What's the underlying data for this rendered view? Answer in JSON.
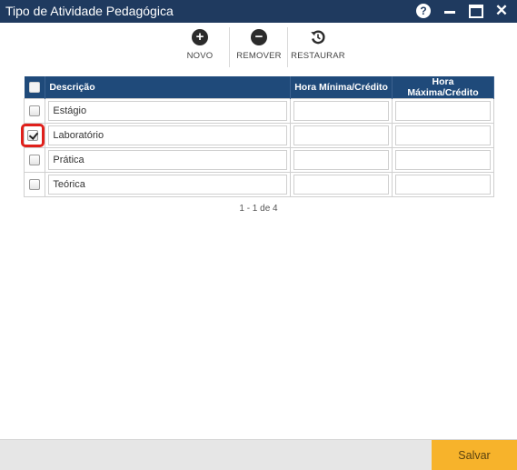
{
  "window": {
    "title": "Tipo de Atividade Pedagógica",
    "help_glyph": "?",
    "close_glyph": "✕"
  },
  "toolbar": {
    "novo_label": "NOVO",
    "remover_label": "REMOVER",
    "restaurar_label": "RESTAURAR",
    "novo_glyph": "+",
    "remover_glyph": "−"
  },
  "grid": {
    "headers": {
      "descricao": "Descrição",
      "hora_min": "Hora Mínima/Crédito",
      "hora_max": "Hora Máxima/Crédito"
    },
    "rows": [
      {
        "descricao": "Estágio",
        "hora_min": "",
        "hora_max": "",
        "checked": false
      },
      {
        "descricao": "Laboratório",
        "hora_min": "",
        "hora_max": "",
        "checked": true
      },
      {
        "descricao": "Prática",
        "hora_min": "",
        "hora_max": "",
        "checked": false
      },
      {
        "descricao": "Teórica",
        "hora_min": "",
        "hora_max": "",
        "checked": false
      }
    ]
  },
  "pager": {
    "text": "1 - 1 de 4"
  },
  "footer": {
    "save_label": "Salvar"
  },
  "colors": {
    "titlebar": "#1f3a5f",
    "grid_header": "#1f4a7a",
    "save_button": "#f7b32b",
    "highlight": "#e0201b"
  }
}
